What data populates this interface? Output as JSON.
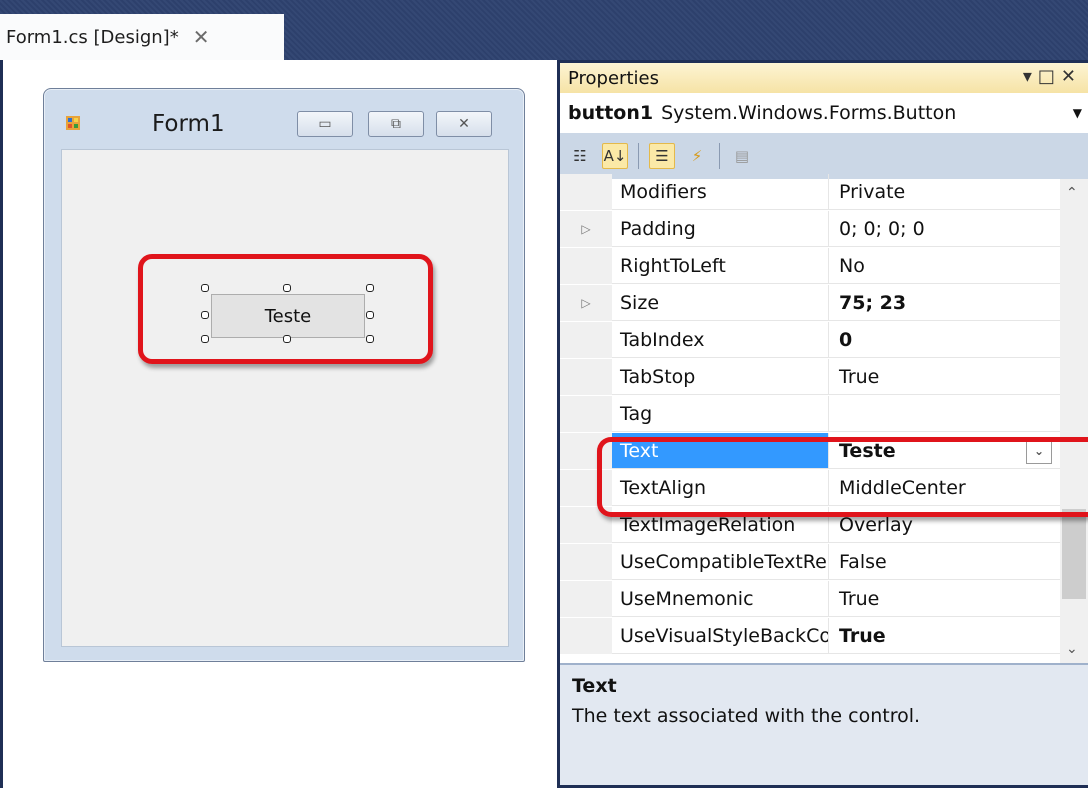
{
  "document_tab": {
    "title": "Form1.cs [Design]*",
    "close_icon": "close-icon"
  },
  "form": {
    "title": "Form1",
    "icon": "form-icon",
    "caption_buttons": [
      "minimize-icon",
      "maximize-icon",
      "close-icon"
    ],
    "button_text": "Teste"
  },
  "properties": {
    "title": "Properties",
    "header_icons": [
      "dropdown-arrow-icon",
      "maximize-icon",
      "close-icon"
    ],
    "object_name": "button1",
    "object_type": "System.Windows.Forms.Button",
    "toolbar_icons": [
      "categorized-icon",
      "alphabetical-icon",
      "properties-icon",
      "events-icon",
      "property-pages-icon"
    ],
    "rows": [
      {
        "name": "Modifiers",
        "value": "Private",
        "expand": false,
        "bold": false
      },
      {
        "name": "Padding",
        "value": "0; 0; 0; 0",
        "expand": true,
        "bold": false
      },
      {
        "name": "RightToLeft",
        "value": "No",
        "expand": false,
        "bold": false
      },
      {
        "name": "Size",
        "value": "75; 23",
        "expand": true,
        "bold": true
      },
      {
        "name": "TabIndex",
        "value": "0",
        "expand": false,
        "bold": true
      },
      {
        "name": "TabStop",
        "value": "True",
        "expand": false,
        "bold": false
      },
      {
        "name": "Tag",
        "value": "",
        "expand": false,
        "bold": false
      },
      {
        "name": "Text",
        "value": "Teste",
        "expand": false,
        "bold": true,
        "selected": true
      },
      {
        "name": "TextAlign",
        "value": "MiddleCenter",
        "expand": false,
        "bold": false
      },
      {
        "name": "TextImageRelation",
        "value": "Overlay",
        "expand": false,
        "bold": false
      },
      {
        "name": "UseCompatibleTextRendering",
        "value": "False",
        "expand": false,
        "bold": false
      },
      {
        "name": "UseMnemonic",
        "value": "True",
        "expand": false,
        "bold": false
      },
      {
        "name": "UseVisualStyleBackColor",
        "value": "True",
        "expand": false,
        "bold": true
      }
    ],
    "description_title": "Text",
    "description_text": "The text associated with the control."
  },
  "colors": {
    "highlight_red": "#e0141b",
    "selection_blue": "#3399ff"
  }
}
